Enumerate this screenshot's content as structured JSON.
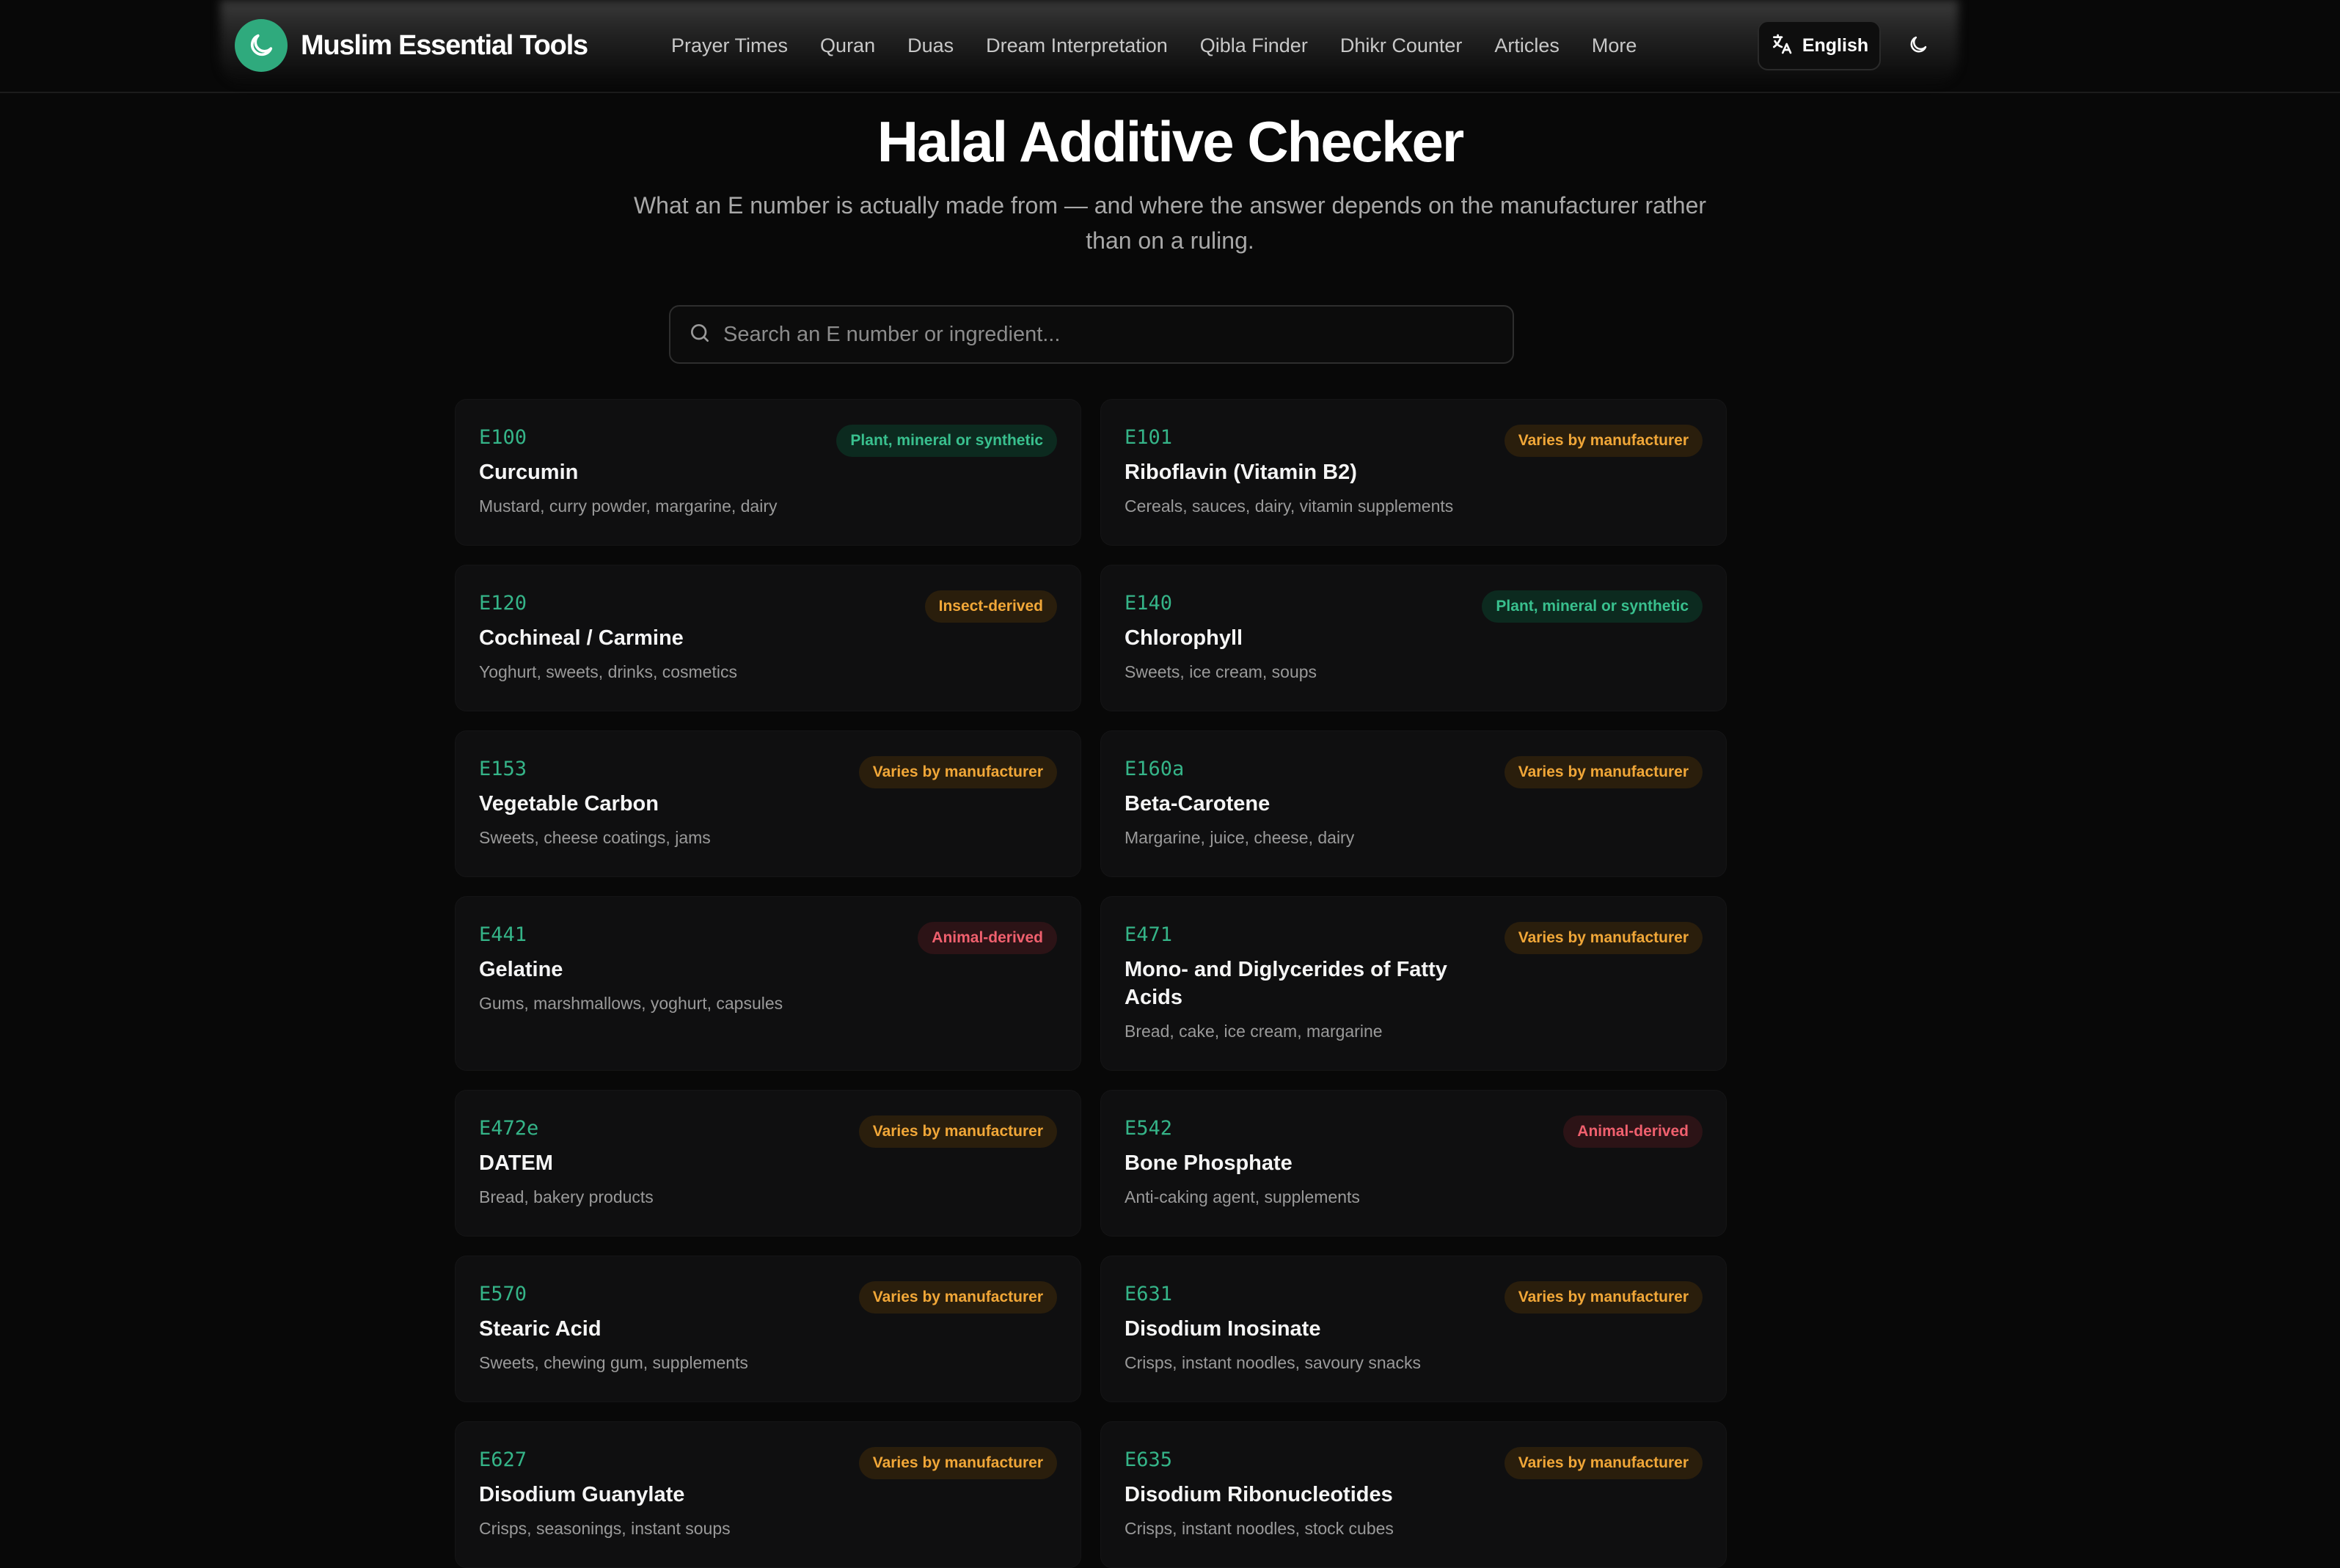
{
  "header": {
    "brand": "Muslim Essential Tools",
    "nav": [
      "Prayer Times",
      "Quran",
      "Duas",
      "Dream Interpretation",
      "Qibla Finder",
      "Dhikr Counter",
      "Articles",
      "More"
    ],
    "language": "English"
  },
  "hero": {
    "title": "Halal Additive Checker",
    "subtitle": "What an E number is actually made from — and where the answer depends on the manufacturer rather than on a ruling."
  },
  "search": {
    "placeholder": "Search an E number or ingredient...",
    "value": ""
  },
  "colors": {
    "accent": "#2faa7d",
    "plant": "#39c08e",
    "varies": "#f1a738",
    "animal": "#f0606e"
  },
  "additives": [
    {
      "code": "E100",
      "name": "Curcumin",
      "uses": "Mustard, curry powder, margarine, dairy",
      "status": "Plant, mineral or synthetic",
      "kind": "plant"
    },
    {
      "code": "E101",
      "name": "Riboflavin (Vitamin B2)",
      "uses": "Cereals, sauces, dairy, vitamin supplements",
      "status": "Varies by manufacturer",
      "kind": "varies"
    },
    {
      "code": "E120",
      "name": "Cochineal / Carmine",
      "uses": "Yoghurt, sweets, drinks, cosmetics",
      "status": "Insect-derived",
      "kind": "insect"
    },
    {
      "code": "E140",
      "name": "Chlorophyll",
      "uses": "Sweets, ice cream, soups",
      "status": "Plant, mineral or synthetic",
      "kind": "plant"
    },
    {
      "code": "E153",
      "name": "Vegetable Carbon",
      "uses": "Sweets, cheese coatings, jams",
      "status": "Varies by manufacturer",
      "kind": "varies"
    },
    {
      "code": "E160a",
      "name": "Beta-Carotene",
      "uses": "Margarine, juice, cheese, dairy",
      "status": "Varies by manufacturer",
      "kind": "varies"
    },
    {
      "code": "E441",
      "name": "Gelatine",
      "uses": "Gums, marshmallows, yoghurt, capsules",
      "status": "Animal-derived",
      "kind": "animal"
    },
    {
      "code": "E471",
      "name": "Mono- and Diglycerides of Fatty Acids",
      "uses": "Bread, cake, ice cream, margarine",
      "status": "Varies by manufacturer",
      "kind": "varies"
    },
    {
      "code": "E472e",
      "name": "DATEM",
      "uses": "Bread, bakery products",
      "status": "Varies by manufacturer",
      "kind": "varies"
    },
    {
      "code": "E542",
      "name": "Bone Phosphate",
      "uses": "Anti-caking agent, supplements",
      "status": "Animal-derived",
      "kind": "animal"
    },
    {
      "code": "E570",
      "name": "Stearic Acid",
      "uses": "Sweets, chewing gum, supplements",
      "status": "Varies by manufacturer",
      "kind": "varies"
    },
    {
      "code": "E631",
      "name": "Disodium Inosinate",
      "uses": "Crisps, instant noodles, savoury snacks",
      "status": "Varies by manufacturer",
      "kind": "varies"
    },
    {
      "code": "E627",
      "name": "Disodium Guanylate",
      "uses": "Crisps, seasonings, instant soups",
      "status": "Varies by manufacturer",
      "kind": "varies"
    },
    {
      "code": "E635",
      "name": "Disodium Ribonucleotides",
      "uses": "Crisps, instant noodles, stock cubes",
      "status": "Varies by manufacturer",
      "kind": "varies"
    }
  ]
}
